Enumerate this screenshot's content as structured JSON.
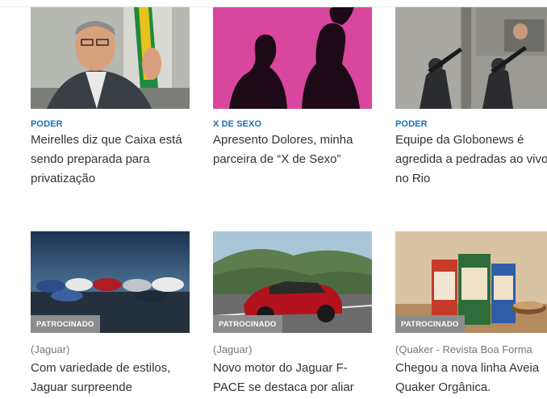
{
  "top_row": [
    {
      "section": "PODER",
      "headline": "Meirelles diz que Caixa está sendo preparada para privatização"
    },
    {
      "section": "X DE SEXO",
      "headline": "Apresento Dolores, minha parceira de “X de Sexo”"
    },
    {
      "section": "PODER",
      "headline": "Equipe da Globonews é agredida a pedradas ao vivo no Rio"
    }
  ],
  "bottom_row": [
    {
      "badge": "PATROCINADO",
      "source": "(Jaguar)",
      "headline": "Com variedade de estilos, Jaguar surpreende"
    },
    {
      "badge": "PATROCINADO",
      "source": "(Jaguar)",
      "headline": "Novo motor do Jaguar F-PACE se destaca por aliar"
    },
    {
      "badge": "PATROCINADO",
      "source": "(Quaker - Revista Boa Forma",
      "headline": "Chegou a nova linha Aveia Quaker Orgânica."
    }
  ],
  "colors": {
    "section": "#1a6fb5",
    "headline": "#333333",
    "badge_bg": "#8c8c8c",
    "source": "#777777"
  }
}
